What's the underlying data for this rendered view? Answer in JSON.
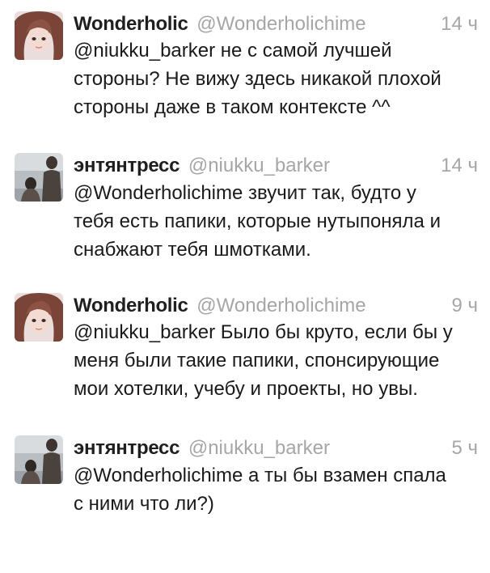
{
  "tweets": [
    {
      "name": "Wonderholic",
      "handle": "@Wonderholichime",
      "time": "14 ч",
      "lines": [
        "@niukku_barker не с самой лучшей",
        "стороны? Не вижу здесь никакой плохой",
        "стороны даже в таком контексте ^^"
      ]
    },
    {
      "name": "энтянтресс",
      "handle": "@niukku_barker",
      "time": "14 ч",
      "lines": [
        "@Wonderholichime звучит так, будто у",
        "тебя есть папики, которые нутыпоняла и",
        "снабжают тебя шмотками."
      ]
    },
    {
      "name": "Wonderholic",
      "handle": "@Wonderholichime",
      "time": "9 ч",
      "lines": [
        "@niukku_barker Было бы круто, если бы у",
        "меня были такие папики, спонсирующие",
        "мои хотелки, учебу и проекты, но увы."
      ]
    },
    {
      "name": "энтянтресс",
      "handle": "@niukku_barker",
      "time": "5 ч",
      "lines": [
        "@Wonderholichime а ты бы взамен спала",
        "с ними что ли?)"
      ]
    }
  ]
}
